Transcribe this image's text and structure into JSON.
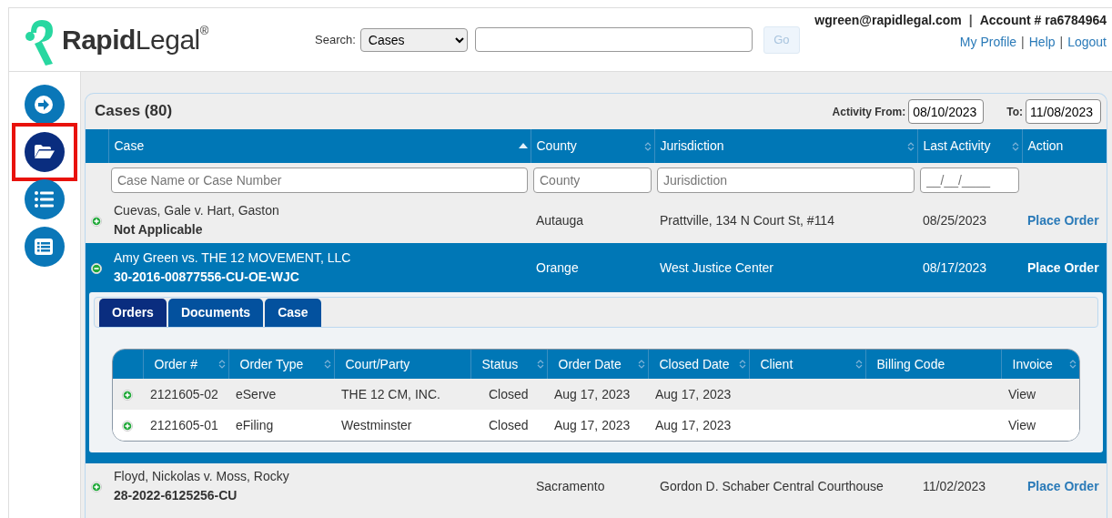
{
  "header": {
    "logo": {
      "text": "**Rapid**Legal$^{®}$"
    },
    "search": {
      "label": "Search:",
      "scope": "Cases",
      "go_button": {
        "label": "Go",
        "disabled": true
      }
    },
    "account": [
      {
        "kind": "text",
        "text": "wgreen@rapidlegal.com"
      },
      {
        "kind": "separator",
        "text": "|"
      },
      {
        "kind": "text",
        "text": "Account # ra6784964"
      }
    ],
    "links": [
      {
        "kind": "link",
        "text": "My Profile"
      },
      {
        "kind": "separator",
        "text": "|"
      },
      {
        "kind": "link",
        "text": "Help"
      },
      {
        "kind": "separator",
        "text": "|"
      },
      {
        "kind": "link",
        "text": "Logout"
      }
    ]
  },
  "sidebar": {
    "items": [
      {
        "kind": "arrow",
        "selected": false,
        "highlighted": false
      },
      {
        "kind": "folder",
        "selected": true,
        "highlighted": true
      },
      {
        "kind": "list",
        "selected": false,
        "highlighted": false
      },
      {
        "kind": "form",
        "selected": false,
        "highlighted": false
      }
    ]
  },
  "cases": {
    "title": "Cases (80)",
    "activity_from": {
      "label": "Activity From:",
      "value": "08/10/2023"
    },
    "activity_to": {
      "label": "To:",
      "value": "11/08/2023"
    },
    "columns": [
      {
        "label": "Case",
        "sortable": true,
        "sorted": true
      },
      {
        "label": "County",
        "sortable": true,
        "sorted": false
      },
      {
        "label": "Jurisdiction",
        "sortable": true,
        "sorted": false
      },
      {
        "label": "Last Activity",
        "sortable": true,
        "sorted": false
      },
      {
        "label": "Action",
        "sortable": false
      }
    ],
    "filters": [
      {
        "placeholder": "Case Name or Case Number"
      },
      {
        "placeholder": "County"
      },
      {
        "placeholder": "Jurisdiction"
      },
      {
        "placeholder": "__/__/____"
      }
    ],
    "rows": [
      {
        "case_name": "Cuevas, Gale v. Hart, Gaston",
        "case_number": "Not Applicable",
        "county": "Autauga",
        "jurisdiction": "Prattville, 134 N Court St, #114",
        "last_activity": "08/25/2023",
        "action": "Place Order",
        "expanded": false,
        "selected": false
      },
      {
        "case_name": "Amy Green vs. THE 12 MOVEMENT, LLC",
        "case_number": "30-2016-00877556-CU-OE-WJC",
        "county": "Orange",
        "jurisdiction": "West Justice Center",
        "last_activity": "08/17/2023",
        "action": "Place Order",
        "expanded": true,
        "selected": true,
        "detail": {
          "tabs": [
            {
              "label": "Orders",
              "selected": true
            },
            {
              "label": "Documents",
              "selected": false
            },
            {
              "label": "Case",
              "selected": false
            }
          ],
          "columns": [
            {
              "label": "Order #",
              "sortable": true
            },
            {
              "label": "Order Type",
              "sortable": true
            },
            {
              "label": "Court/Party",
              "sortable": false
            },
            {
              "label": "Status",
              "sortable": true
            },
            {
              "label": "Order Date",
              "sortable": true
            },
            {
              "label": "Closed Date",
              "sortable": true
            },
            {
              "label": "Client",
              "sortable": true
            },
            {
              "label": "Billing Code",
              "sortable": false
            },
            {
              "label": "Invoice",
              "sortable": true
            }
          ],
          "orders": [
            {
              "order_no": "2121605-02",
              "order_type": "eServe",
              "court_party": "THE 12 CM, INC.",
              "status": "Closed",
              "order_date": "Aug 17, 2023",
              "closed_date": "Aug 17, 2023",
              "invoice": "View",
              "expanded": false
            },
            {
              "order_no": "2121605-01",
              "order_type": "eFiling",
              "court_party": "Westminster",
              "status": "Closed",
              "order_date": "Aug 17, 2023",
              "closed_date": "Aug 17, 2023",
              "invoice": "View",
              "expanded": false
            }
          ]
        }
      },
      {
        "case_name": "Floyd, Nickolas v. Moss, Rocky",
        "case_number": "28-2022-6125256-CU",
        "county": "Sacramento",
        "jurisdiction": "Gordon D. Schaber Central Courthouse",
        "last_activity": "11/02/2023",
        "action": "Place Order",
        "expanded": false,
        "selected": false
      }
    ]
  }
}
